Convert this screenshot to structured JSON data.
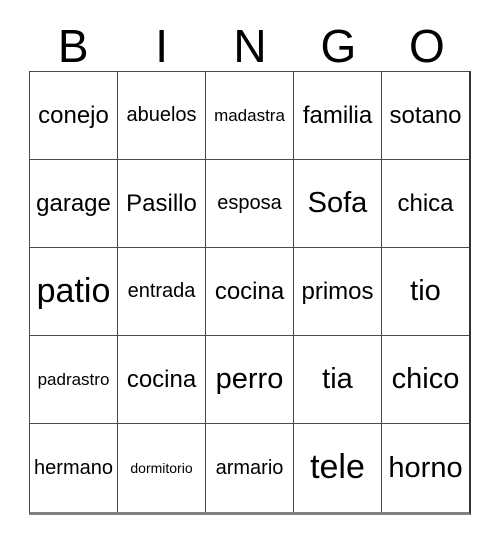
{
  "header": {
    "letters": [
      "B",
      "I",
      "N",
      "G",
      "O"
    ]
  },
  "grid": {
    "rows": [
      [
        {
          "text": "conejo",
          "size": "l"
        },
        {
          "text": "abuelos",
          "size": "m"
        },
        {
          "text": "madastra",
          "size": "s"
        },
        {
          "text": "familia",
          "size": "l"
        },
        {
          "text": "sotano",
          "size": "l"
        }
      ],
      [
        {
          "text": "garage",
          "size": "l"
        },
        {
          "text": "Pasillo",
          "size": "l"
        },
        {
          "text": "esposa",
          "size": "m"
        },
        {
          "text": "Sofa",
          "size": "xl"
        },
        {
          "text": "chica",
          "size": "l"
        }
      ],
      [
        {
          "text": "patio",
          "size": "xxl"
        },
        {
          "text": "entrada",
          "size": "m"
        },
        {
          "text": "cocina",
          "size": "l"
        },
        {
          "text": "primos",
          "size": "l"
        },
        {
          "text": "tio",
          "size": "xl"
        }
      ],
      [
        {
          "text": "padrastro",
          "size": "s"
        },
        {
          "text": "cocina",
          "size": "l"
        },
        {
          "text": "perro",
          "size": "xl"
        },
        {
          "text": "tia",
          "size": "xl"
        },
        {
          "text": "chico",
          "size": "xl"
        }
      ],
      [
        {
          "text": "hermano",
          "size": "m"
        },
        {
          "text": "dormitorio",
          "size": "xs"
        },
        {
          "text": "armario",
          "size": "m"
        },
        {
          "text": "tele",
          "size": "xxl"
        },
        {
          "text": "horno",
          "size": "xl"
        }
      ]
    ]
  },
  "colors": {
    "background": "#ffffff",
    "text": "#000000",
    "grid_line": "#4a4a4a",
    "grid_bottom": "#808080"
  }
}
